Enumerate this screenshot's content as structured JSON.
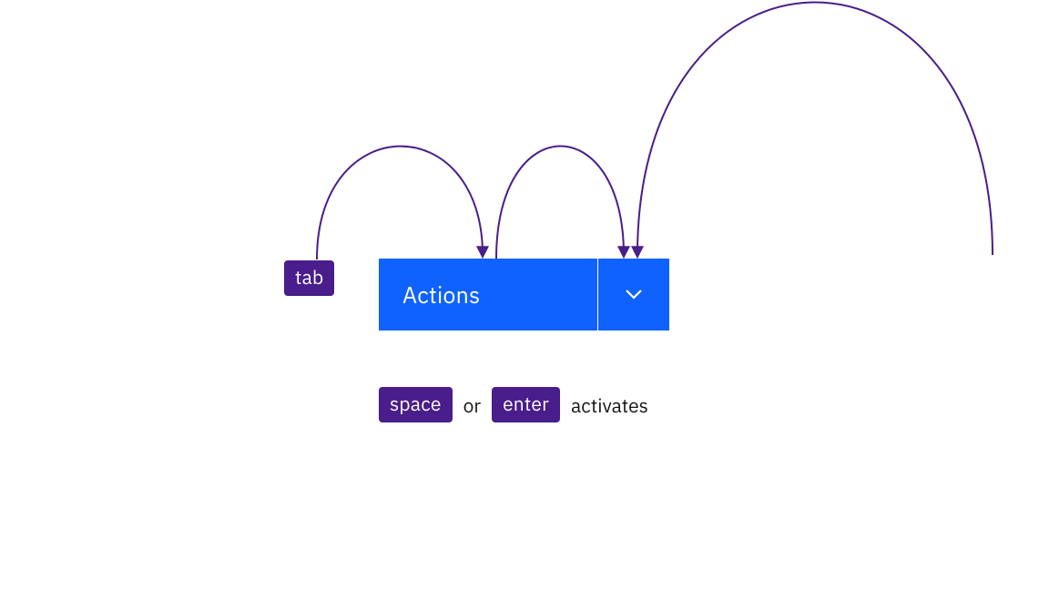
{
  "keys": {
    "tab": "tab",
    "space": "space",
    "enter": "enter"
  },
  "button": {
    "label": "Actions"
  },
  "instruction": {
    "or": "or",
    "activates": "activates"
  },
  "colors": {
    "key_bg": "#491d8b",
    "button_bg": "#0f62fe",
    "arc_stroke": "#491d8b"
  }
}
